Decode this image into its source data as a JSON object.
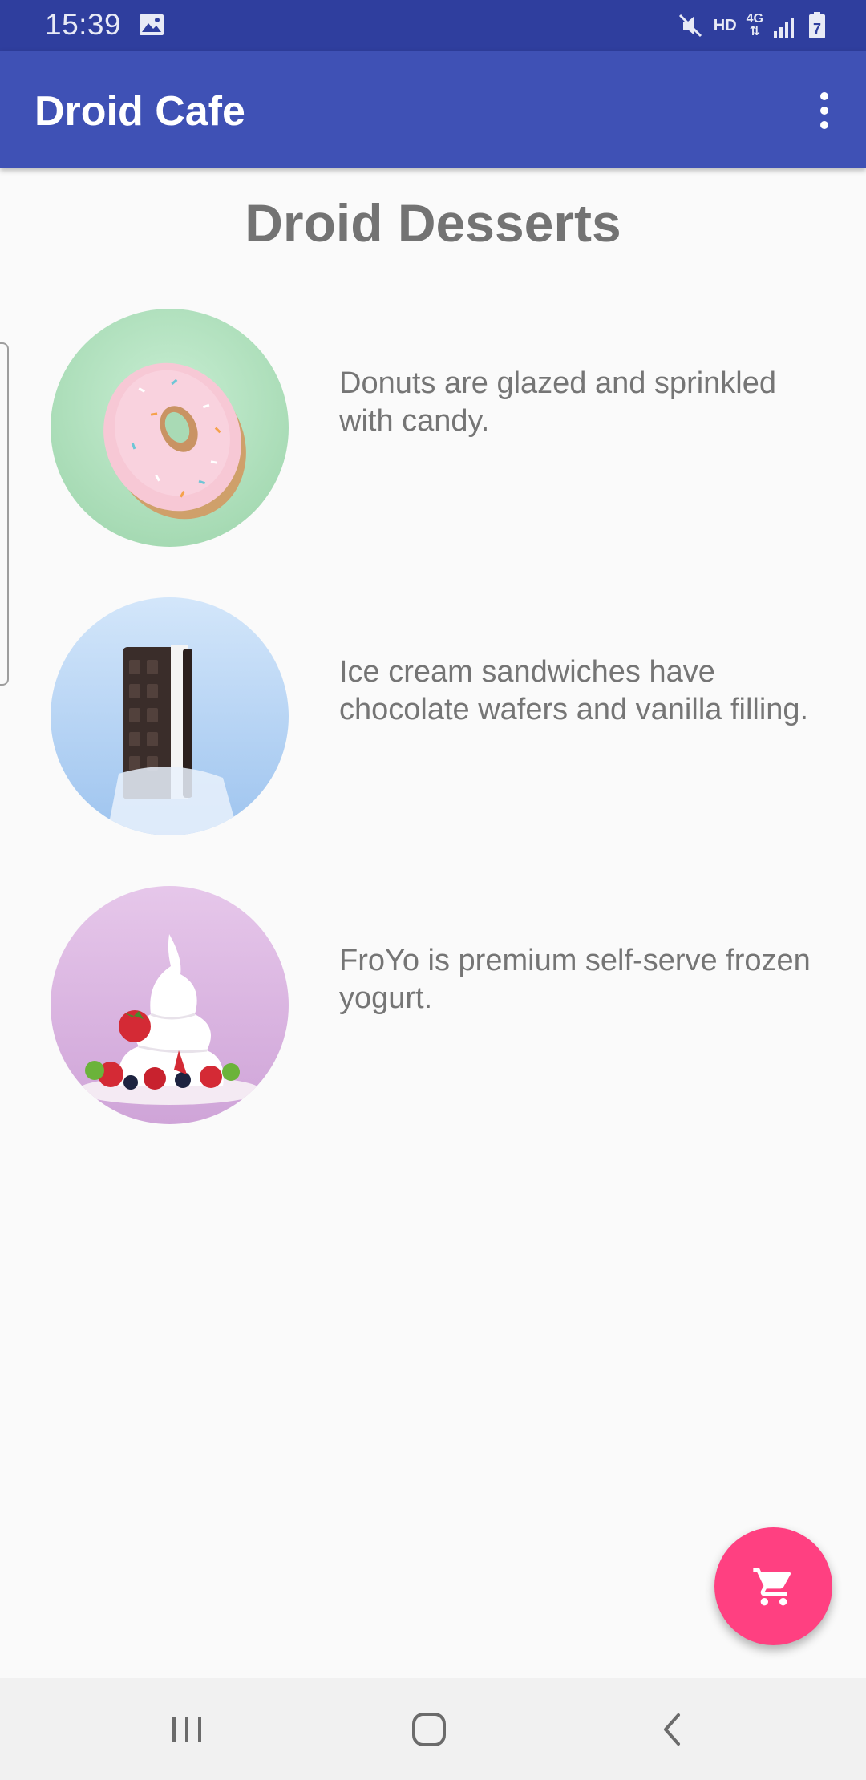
{
  "status_bar": {
    "time": "15:39",
    "hd_label": "HD",
    "network_label": "4G",
    "battery_level": "7",
    "icons": [
      "gallery-icon",
      "mute-icon",
      "signal-icon",
      "battery-icon"
    ]
  },
  "app_bar": {
    "title": "Droid Cafe",
    "overflow_icon": "more-vert-icon"
  },
  "page": {
    "heading": "Droid Desserts"
  },
  "desserts": [
    {
      "name": "donut",
      "description": "Donuts are glazed and sprinkled with candy."
    },
    {
      "name": "ice-cream-sandwich",
      "description": "Ice cream sandwiches have chocolate wafers and vanilla filling."
    },
    {
      "name": "froyo",
      "description": "FroYo is premium self-serve frozen yogurt."
    }
  ],
  "fab": {
    "icon": "shopping-cart-icon"
  },
  "colors": {
    "status_bar": "#2f3e9e",
    "app_bar": "#3f51b5",
    "fab": "#ff4081",
    "heading_text": "#737373",
    "body_text": "#757575"
  },
  "nav_bar": {
    "icons": [
      "recents-icon",
      "home-icon",
      "back-icon"
    ]
  }
}
